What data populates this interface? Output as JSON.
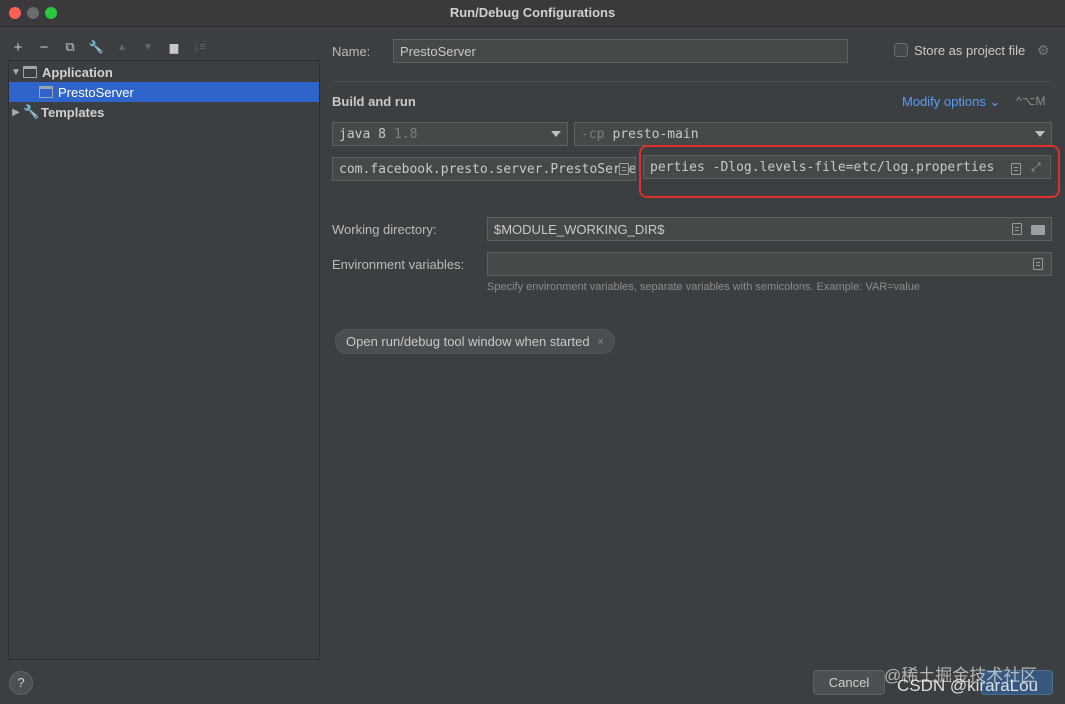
{
  "window": {
    "title": "Run/Debug Configurations"
  },
  "toolbar": {
    "add": "+",
    "remove": "−",
    "copy": "⧉",
    "edit": "🔧",
    "up": "▲",
    "down": "▼",
    "folder": "▆",
    "sort": "↓≡"
  },
  "tree": {
    "items": [
      {
        "label": "Application"
      },
      {
        "label": "PrestoServer"
      },
      {
        "label": "Templates"
      }
    ]
  },
  "form": {
    "name_label": "Name:",
    "name_value": "PrestoServer",
    "store_label": "Store as project file",
    "section_title": "Build and run",
    "modify_options": "Modify options ⌄",
    "modify_shortcut": "^⌥M",
    "jre_value": "java 8",
    "jre_version": "1.8",
    "cp_prefix": "-cp",
    "cp_value": "presto-main",
    "main_class": "com.facebook.presto.server.PrestoServer",
    "vm_options": "perties -Dlog.levels-file=etc/log.properties",
    "workdir_label": "Working directory:",
    "workdir_value": "$MODULE_WORKING_DIR$",
    "env_label": "Environment variables:",
    "env_value": "",
    "env_hint": "Specify environment variables, separate variables with semicolons. Example: VAR=value",
    "chip_label": "Open run/debug tool window when started",
    "chip_close": "×"
  },
  "footer": {
    "help": "?",
    "cancel": "Cancel"
  },
  "watermark": {
    "line1": "@稀土掘金技术社区",
    "line2": "CSDN @kiraraLou"
  },
  "colors": {
    "accent": "#2f65ca",
    "link": "#589df6",
    "highlight": "#e0302a"
  }
}
